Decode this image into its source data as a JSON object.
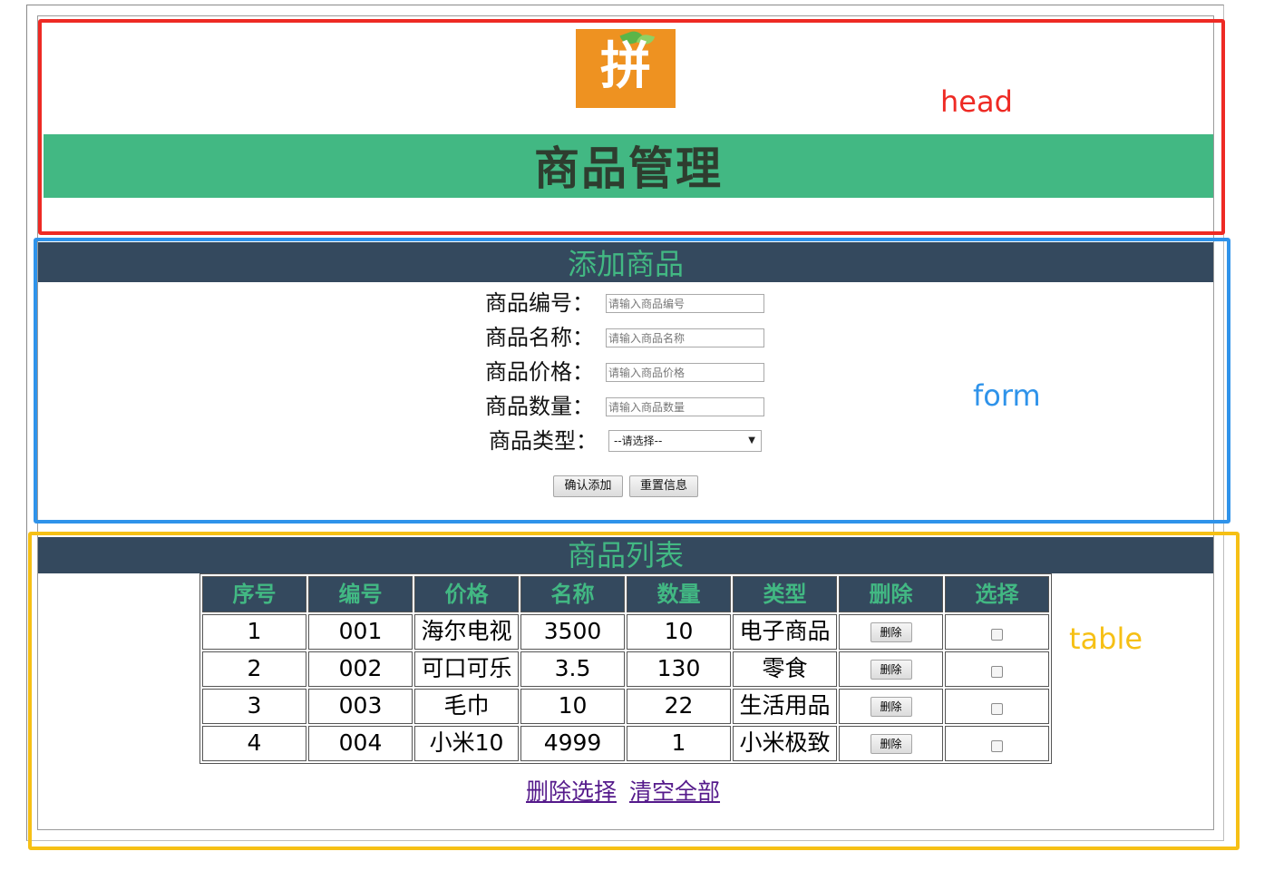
{
  "head": {
    "logo_text": "拼",
    "title": "商品管理"
  },
  "annotations": {
    "head": "head",
    "form": "form",
    "table": "table",
    "colors": {
      "head": "#ee2a24",
      "form": "#2f93ea",
      "table": "#f6c015"
    }
  },
  "form": {
    "section_title": "添加商品",
    "fields": [
      {
        "label": "商品编号：",
        "placeholder": "请输入商品编号"
      },
      {
        "label": "商品名称：",
        "placeholder": "请输入商品名称"
      },
      {
        "label": "商品价格：",
        "placeholder": "请输入商品价格"
      },
      {
        "label": "商品数量：",
        "placeholder": "请输入商品数量"
      }
    ],
    "type_label": "商品类型：",
    "type_select": "--请选择--",
    "confirm_button": "确认添加",
    "reset_button": "重置信息"
  },
  "table": {
    "section_title": "商品列表",
    "headers": [
      "序号",
      "编号",
      "价格",
      "名称",
      "数量",
      "类型",
      "删除",
      "选择"
    ],
    "rows": [
      [
        "1",
        "001",
        "海尔电视",
        "3500",
        "10",
        "电子商品"
      ],
      [
        "2",
        "002",
        "可口可乐",
        "3.5",
        "130",
        "零食"
      ],
      [
        "3",
        "003",
        "毛巾",
        "10",
        "22",
        "生活用品"
      ],
      [
        "4",
        "004",
        "小米10",
        "4999",
        "1",
        "小米极致"
      ]
    ],
    "delete_label": "删除",
    "delete_selected_link": "删除选择",
    "clear_all_link": "清空全部"
  },
  "theme": {
    "green": "#42b883",
    "dark": "#34495e",
    "logo_orange": "#ee9221"
  }
}
